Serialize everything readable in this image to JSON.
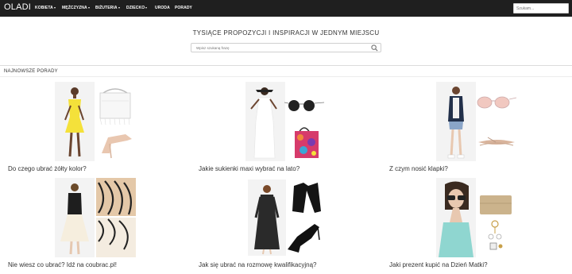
{
  "nav": {
    "logo": "OLADI",
    "items": [
      {
        "label": "KOBIETA",
        "dropdown": true
      },
      {
        "label": "MĘŻCZYZNA",
        "dropdown": true
      },
      {
        "label": "BIŻUTERIA",
        "dropdown": true
      },
      {
        "label": "DZIECKO",
        "dropdown": true
      },
      {
        "label": "URODA",
        "dropdown": false
      },
      {
        "label": "PORADY",
        "dropdown": false
      }
    ],
    "search_placeholder": "Szukam..."
  },
  "hero": {
    "title": "TYSIĄCE PROPOZYCJI I INSPIRACJI W JEDNYM MIEJSCU",
    "search_placeholder": "Wpisz szukaną frazę"
  },
  "section": {
    "title": "NAJNOWSZE PORADY"
  },
  "cards": [
    {
      "title": "Do czego ubrać żółty kolor?"
    },
    {
      "title": "Jakie sukienki maxi wybrać na lato?"
    },
    {
      "title": "Z czym nosić klapki?"
    },
    {
      "title": "Nie wiesz co ubrać? Idź na coubrac.pl!"
    },
    {
      "title": "Jak się ubrać na rozmowę kwalifikacyjną?"
    },
    {
      "title": "Jaki prezent kupić na Dzień Matki?"
    }
  ],
  "colors": {
    "navbar": "#1f1f1f",
    "text": "#333333",
    "border": "#dcdcdc"
  }
}
